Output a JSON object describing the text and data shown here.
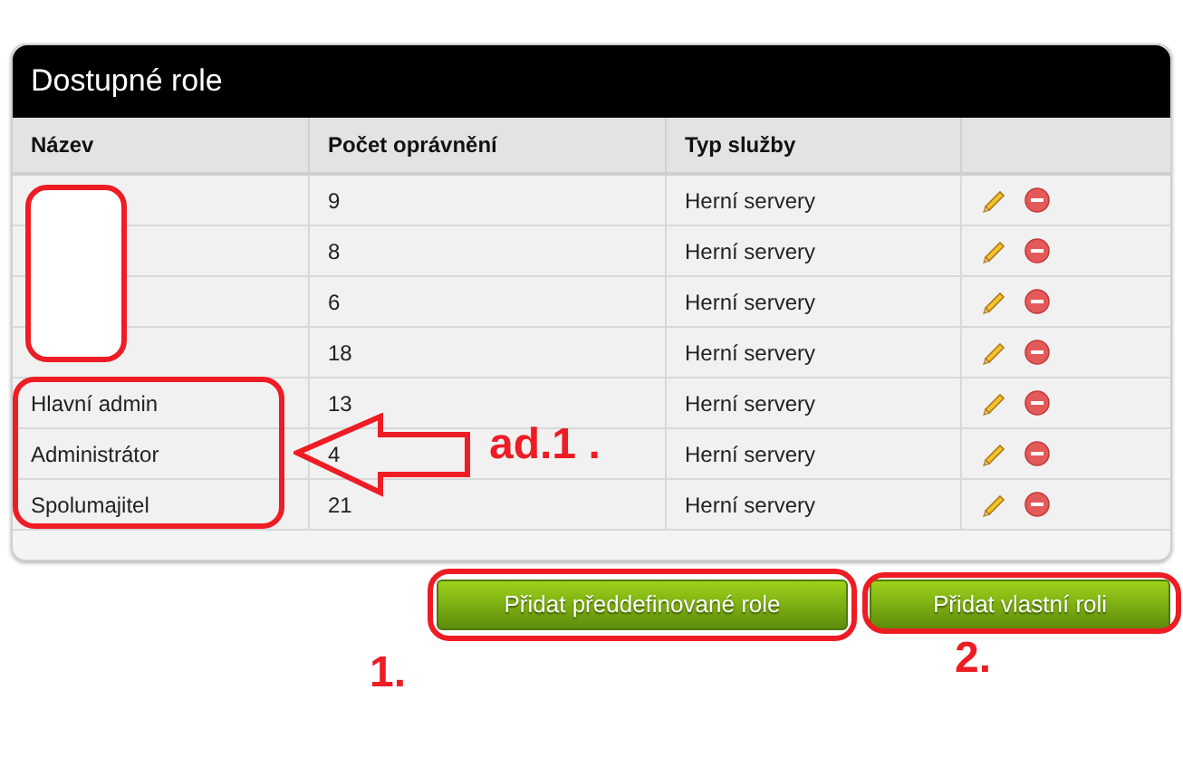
{
  "panel": {
    "title": "Dostupné role"
  },
  "table": {
    "columns": [
      "Název",
      "Počet oprávnění",
      "Typ služby"
    ],
    "rows": [
      {
        "count": "9",
        "service": "Herní servery"
      },
      {
        "count": "8",
        "service": "Herní servery"
      },
      {
        "count": "6",
        "service": "Herní servery"
      },
      {
        "count": "18",
        "service": "Herní servery"
      },
      {
        "name": "Hlavní admin",
        "count": "13",
        "service": "Herní servery"
      },
      {
        "name": "Administrátor",
        "count": "4",
        "service": "Herní servery"
      },
      {
        "name": "Spolumajitel",
        "count": "21",
        "service": "Herní servery"
      }
    ]
  },
  "buttons": [
    "Přidat předdefinované role",
    "Přidat vlastní roli"
  ],
  "annotations": [
    {
      "kind": "redaction"
    },
    {
      "kind": "outline"
    },
    {
      "kind": "arrow"
    },
    {
      "kind": "label",
      "text": "ad.1 ."
    },
    {
      "kind": "outline"
    },
    {
      "kind": "label",
      "text": "1."
    },
    {
      "kind": "outline"
    },
    {
      "kind": "label",
      "text": "2."
    }
  ]
}
